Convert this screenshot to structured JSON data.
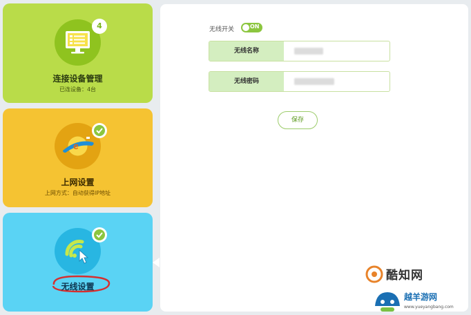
{
  "cards": [
    {
      "title": "连接设备管理",
      "subtitle": "已连设备：4台",
      "badge": "4",
      "icon": "monitor-icon",
      "color": "#b9dc49"
    },
    {
      "title": "上网设置",
      "subtitle": "上网方式：自动获得IP地址",
      "badge": "✓",
      "icon": "internet-globe-icon",
      "color": "#f5c332"
    },
    {
      "title": "无线设置",
      "badge": "✓",
      "icon": "wifi-cursor-icon",
      "color": "#5ad3f4",
      "selected": true
    }
  ],
  "wireless": {
    "toggle_label": "无线开关",
    "toggle_state": "ON",
    "ssid_label": "无线名称",
    "password_label": "无线密码",
    "save_label": "保存"
  },
  "colors": {
    "accent": "#8cc63f",
    "field_label_bg": "#d4eec0",
    "panel_bg": "#ffffff",
    "page_bg": "#e8ecef"
  },
  "watermarks": {
    "top": "酷知网",
    "bottom_title": "越羊游网",
    "bottom_url": "www.yueyangbang.com"
  }
}
